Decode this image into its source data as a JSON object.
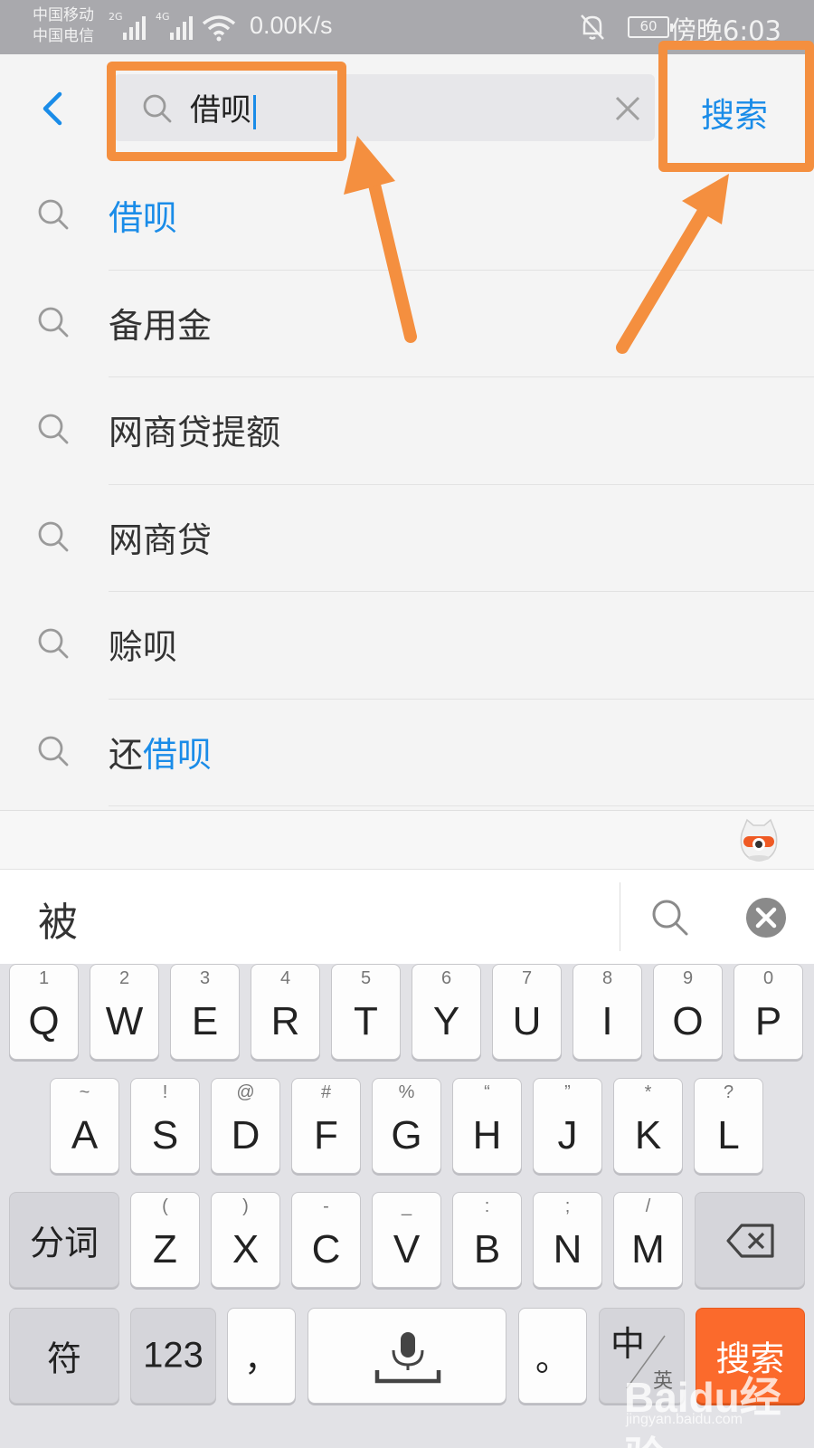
{
  "status_bar": {
    "carrier_1": "中国移动",
    "carrier_2": "中国电信",
    "net_1": "2G",
    "net_2": "4G",
    "speed": "0.00K/s",
    "battery": "60",
    "time": "傍晚6:03",
    "icons": [
      "signal-icon",
      "wifi-icon",
      "mute-bell-icon",
      "battery-icon"
    ]
  },
  "search": {
    "query": "借呗",
    "submit_label": "搜索",
    "accent_color": "#1a8ce8"
  },
  "suggestions": [
    {
      "prefix": "",
      "highlight": "借呗",
      "suffix": ""
    },
    {
      "prefix": "备用金",
      "highlight": "",
      "suffix": ""
    },
    {
      "prefix": "网商贷提额",
      "highlight": "",
      "suffix": ""
    },
    {
      "prefix": "网商贷",
      "highlight": "",
      "suffix": ""
    },
    {
      "prefix": "赊呗",
      "highlight": "",
      "suffix": ""
    },
    {
      "prefix": "还",
      "highlight": "借呗",
      "suffix": ""
    }
  ],
  "keyboard": {
    "candidate": "被",
    "row1": [
      {
        "main": "Q",
        "sub": "1"
      },
      {
        "main": "W",
        "sub": "2"
      },
      {
        "main": "E",
        "sub": "3"
      },
      {
        "main": "R",
        "sub": "4"
      },
      {
        "main": "T",
        "sub": "5"
      },
      {
        "main": "Y",
        "sub": "6"
      },
      {
        "main": "U",
        "sub": "7"
      },
      {
        "main": "I",
        "sub": "8"
      },
      {
        "main": "O",
        "sub": "9"
      },
      {
        "main": "P",
        "sub": "0"
      }
    ],
    "row2": [
      {
        "main": "A",
        "sub": "~"
      },
      {
        "main": "S",
        "sub": "!"
      },
      {
        "main": "D",
        "sub": "@"
      },
      {
        "main": "F",
        "sub": "#"
      },
      {
        "main": "G",
        "sub": "%"
      },
      {
        "main": "H",
        "sub": "“"
      },
      {
        "main": "J",
        "sub": "”"
      },
      {
        "main": "K",
        "sub": "*"
      },
      {
        "main": "L",
        "sub": "?"
      }
    ],
    "row3": [
      {
        "main": "Z",
        "sub": "("
      },
      {
        "main": "X",
        "sub": ")"
      },
      {
        "main": "C",
        "sub": "-"
      },
      {
        "main": "V",
        "sub": "_"
      },
      {
        "main": "B",
        "sub": ":"
      },
      {
        "main": "N",
        "sub": ";"
      },
      {
        "main": "M",
        "sub": "/"
      }
    ],
    "segment_label": "分词",
    "symbol_label": "符",
    "number_label": "123",
    "comma": "，",
    "period": "。",
    "lang_label": "中",
    "lang_sub": "英",
    "enter_label": "搜索",
    "enter_color": "#fb6a2c"
  },
  "annotation": {
    "color": "#f48f3f"
  },
  "watermark": {
    "brand": "Baidu经验",
    "url": "jingyan.baidu.com"
  }
}
